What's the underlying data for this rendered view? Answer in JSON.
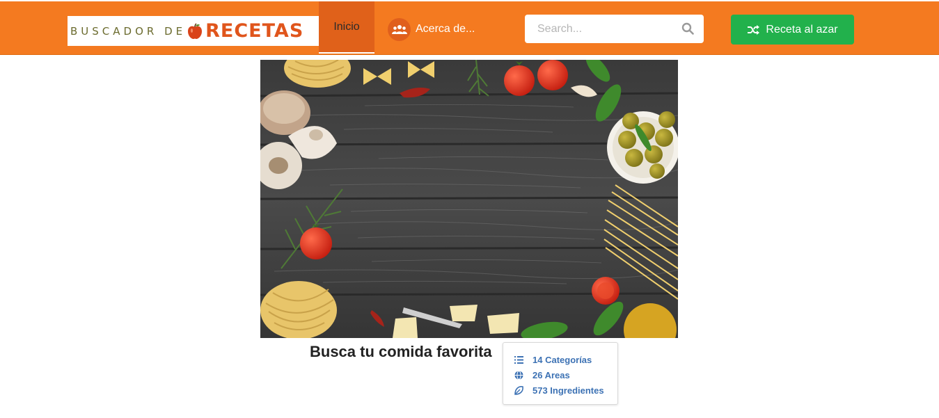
{
  "header": {
    "logo": {
      "text_small": "BUSCADOR DE",
      "text_big": "RECETAS"
    },
    "nav": {
      "home_label": "Inicio",
      "about_label": "Acerca de..."
    },
    "search": {
      "placeholder": "Search...",
      "value": ""
    },
    "random_button_label": "Receta al azar"
  },
  "hero": {
    "image": "food-frame-photo"
  },
  "main": {
    "tagline": "Busca tu comida favorita",
    "stats": [
      {
        "icon": "list-icon",
        "label": "14 Categorías"
      },
      {
        "icon": "globe-icon",
        "label": "26 Areas"
      },
      {
        "icon": "leaf-icon",
        "label": "573 Ingredientes"
      }
    ]
  },
  "colors": {
    "navbar": "#f47a20",
    "active_tab": "#e0611a",
    "random_button": "#22b14c",
    "link": "#3d72b4"
  }
}
